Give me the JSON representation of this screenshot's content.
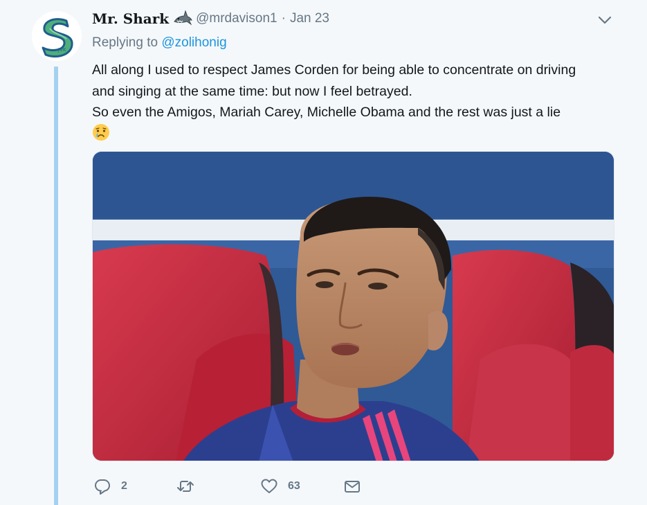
{
  "tweet": {
    "display_name": "Mr. Shark",
    "name_emoji": "shark-emoji",
    "handle": "@mrdavison1",
    "separator": "·",
    "date": "Jan 23",
    "replying_prefix": "Replying to",
    "replying_to": "@zolihonig",
    "text_lines": [
      "All along I used to respect James Corden for being able to concentrate on driving",
      "and singing at the same time: but now I feel betrayed.",
      "So even the Amigos, Mariah Carey, Michelle Obama and the rest was just a lie"
    ],
    "trailing_emoji": "crying-face-emoji"
  },
  "actions": {
    "reply_count": "2",
    "retweet_count": "",
    "like_count": "63",
    "dm_count": ""
  },
  "colors": {
    "background": "#f5f8fa",
    "text": "#14171a",
    "secondary": "#657786",
    "link": "#1b95e0",
    "thread_line": "#a5d1f0",
    "avatar_logo": "#2e9e7a"
  },
  "icons": {
    "caret": "chevron-down-icon",
    "reply": "reply-icon",
    "retweet": "retweet-icon",
    "like": "heart-icon",
    "message": "envelope-icon"
  }
}
